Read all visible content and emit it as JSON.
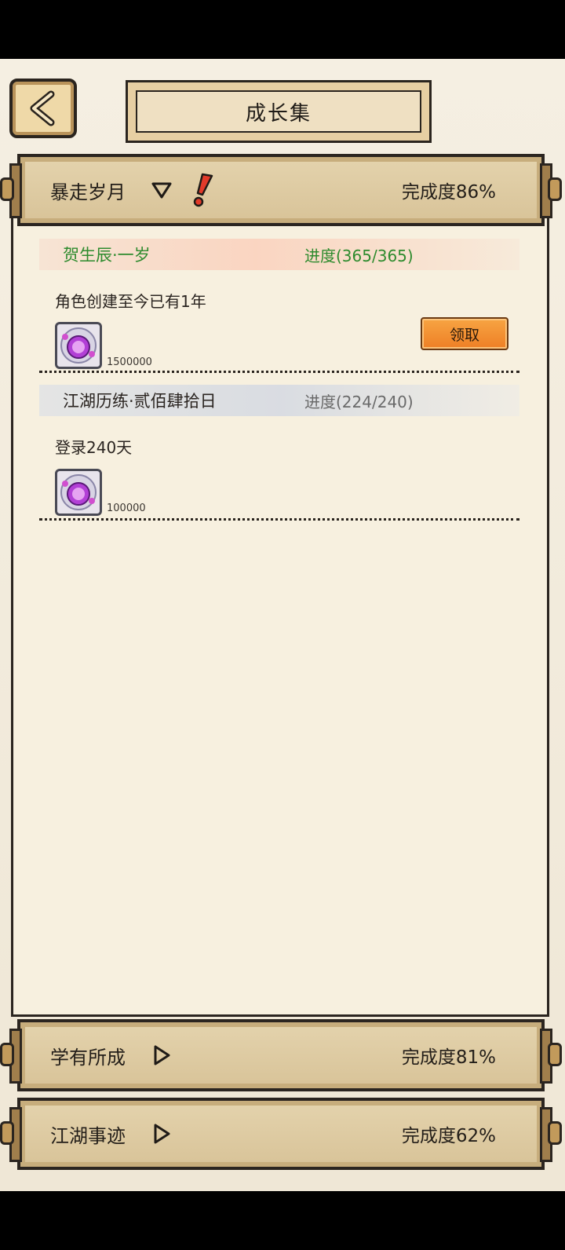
{
  "header": {
    "title": "成长集"
  },
  "sections": [
    {
      "title": "暴走岁月",
      "expanded": true,
      "completion": "完成度86%",
      "entries": [
        {
          "name": "贺生辰·一岁",
          "progress": "进度(365/365)",
          "description": "角色创建至今已有1年",
          "reward_qty": "1500000",
          "completed": true,
          "claim_label": "领取"
        },
        {
          "name": "江湖历练·贰佰肆拾日",
          "progress": "进度(224/240)",
          "description": "登录240天",
          "reward_qty": "100000",
          "completed": false
        }
      ]
    },
    {
      "title": "学有所成",
      "expanded": false,
      "completion": "完成度81%"
    },
    {
      "title": "江湖事迹",
      "expanded": false,
      "completion": "完成度62%"
    }
  ],
  "colors": {
    "completed_text": "#2e8b2e",
    "pending_text": "#6a6a6a",
    "claim_button": "#f0892c",
    "alert": "#e23a2a"
  },
  "icons": {
    "back": "chevron-left-icon",
    "expanded": "triangle-down-icon",
    "collapsed": "triangle-right-icon",
    "alert": "exclamation-icon",
    "reward": "purple-orb-icon"
  }
}
